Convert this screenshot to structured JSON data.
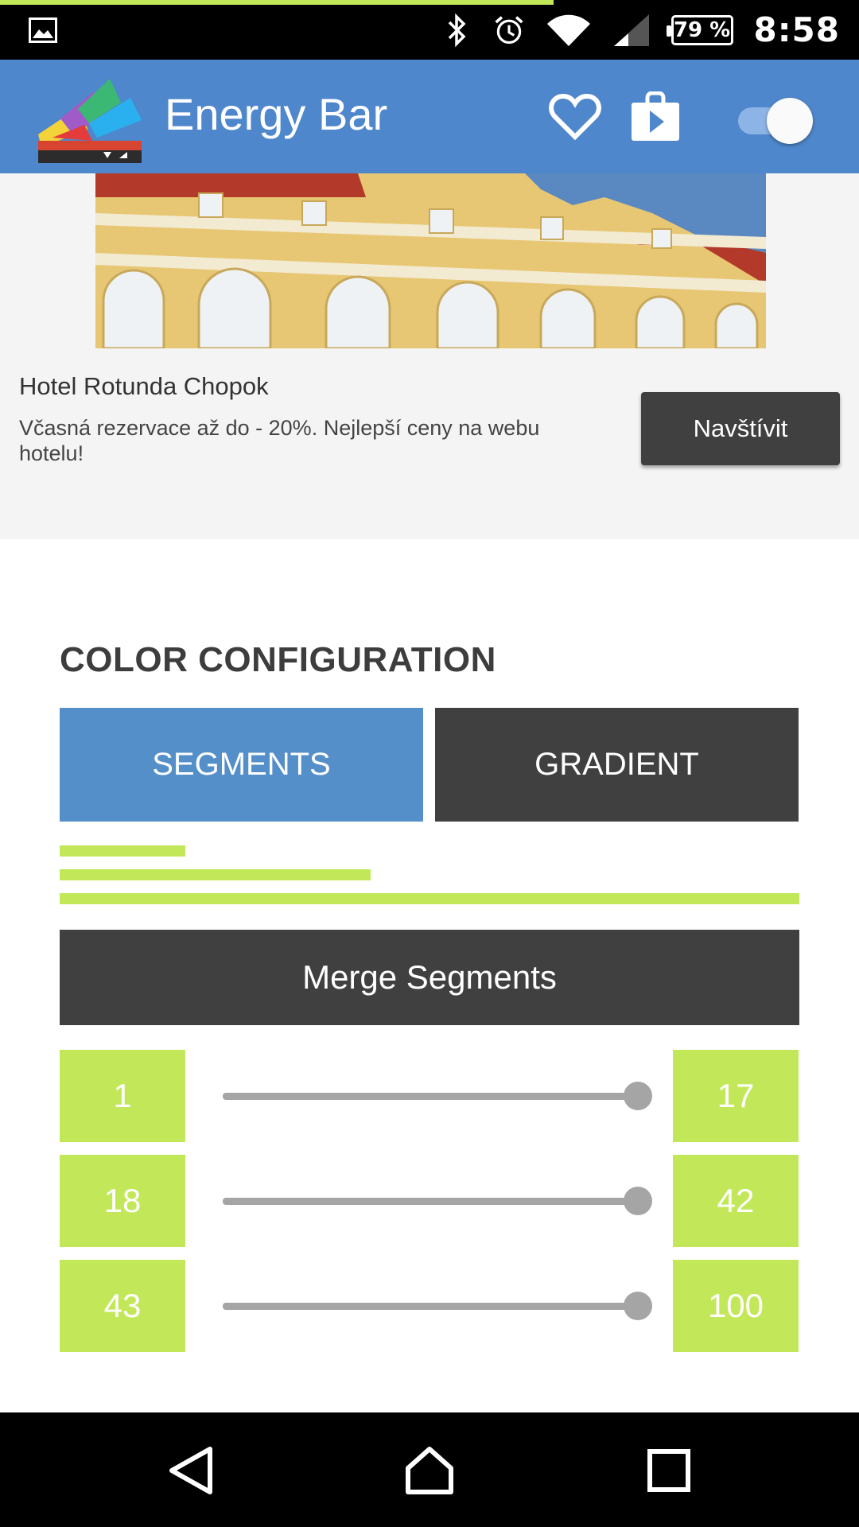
{
  "status_bar": {
    "battery": "79 %",
    "time": "8:58",
    "icons": [
      "gallery-icon",
      "bluetooth-icon",
      "alarm-icon",
      "wifi-icon",
      "signal-icon",
      "battery-icon"
    ]
  },
  "energy_bar": {
    "level": 0.644,
    "color": "#c2e85a"
  },
  "app_bar": {
    "title": "Energy Bar",
    "icons": [
      "app-logo-icon",
      "heart-icon",
      "play-store-icon"
    ],
    "toggle_on": true,
    "color": "#4f87cc"
  },
  "ad": {
    "title": "Hotel Rotunda Chopok",
    "description": "Včasná rezervace až do - 20%. Nejlepší ceny na webu hotelu!",
    "button_label": "Navštívit"
  },
  "color_config": {
    "section_title": "COLOR CONFIGURATION",
    "tabs": [
      {
        "label": "SEGMENTS",
        "selected": true,
        "color": "#548fca"
      },
      {
        "label": "GRADIENT",
        "selected": false,
        "color": "#404040"
      }
    ],
    "preview_segments": [
      {
        "from": 1,
        "to": 17
      },
      {
        "from": 18,
        "to": 42
      },
      {
        "from": 43,
        "to": 100
      }
    ],
    "merge_button_label": "Merge Segments",
    "segments": [
      {
        "start": "1",
        "end": "17",
        "slider_value": 1.0
      },
      {
        "start": "18",
        "end": "42",
        "slider_value": 1.0
      },
      {
        "start": "43",
        "end": "100",
        "slider_value": 1.0
      }
    ],
    "segment_color": "#c2e85a"
  },
  "nav_bar": {
    "icons": [
      "back-icon",
      "home-icon",
      "recents-icon"
    ]
  }
}
